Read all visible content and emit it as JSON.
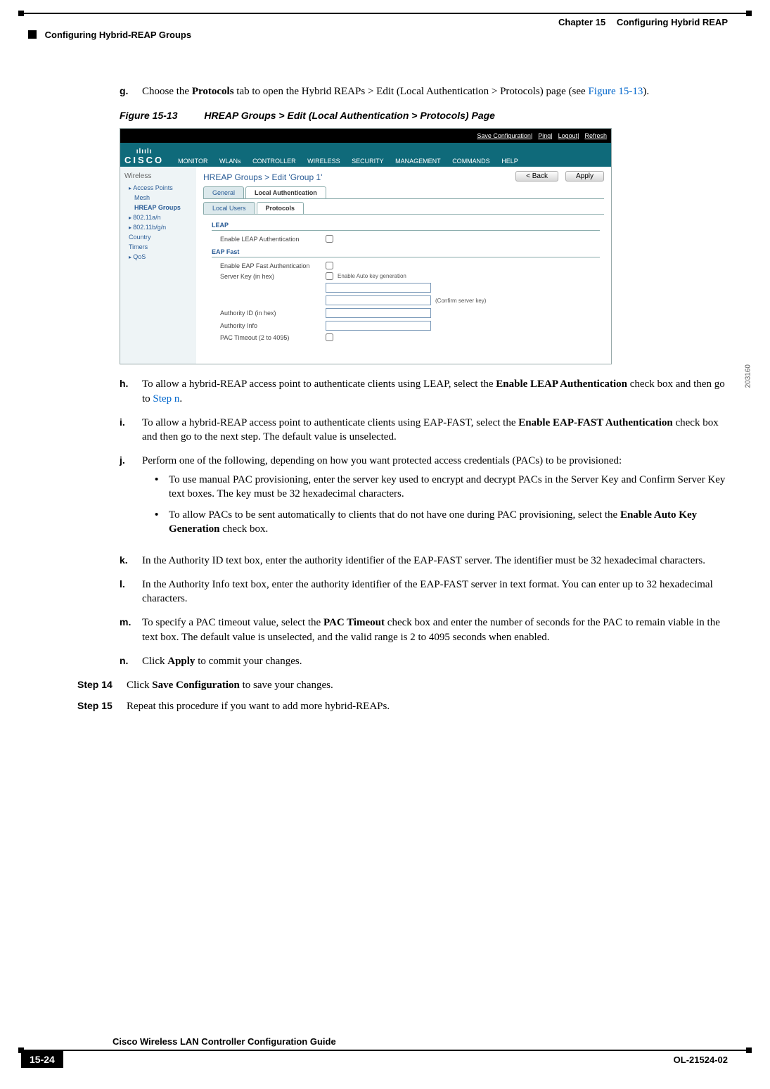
{
  "header": {
    "chapter": "Chapter 15",
    "chapter_title": "Configuring Hybrid REAP",
    "section": "Configuring Hybrid-REAP Groups"
  },
  "footer": {
    "guide_title": "Cisco Wireless LAN Controller Configuration Guide",
    "page_number": "15-24",
    "doc_id": "OL-21524-02"
  },
  "step_g": {
    "marker": "g.",
    "t1": "Choose the ",
    "b1": "Protocols",
    "t2": " tab to open the Hybrid REAPs > Edit (Local Authentication > Protocols) page (see ",
    "link": "Figure 15-13",
    "t3": ")."
  },
  "figure": {
    "label": "Figure 15-13",
    "caption": "HREAP Groups > Edit (Local Authentication > Protocols) Page",
    "image_id": "203160",
    "topbar": {
      "save": "Save Configuration",
      "ping": "Ping",
      "logout": "Logout",
      "refresh": "Refresh"
    },
    "logo_top": "ılıılı",
    "logo": "CISCO",
    "menu": [
      "MONITOR",
      "WLANs",
      "CONTROLLER",
      "WIRELESS",
      "SECURITY",
      "MANAGEMENT",
      "COMMANDS",
      "HELP"
    ],
    "sidebar_title": "Wireless",
    "sidebar": {
      "ap": "Access Points",
      "mesh": "Mesh",
      "hreap": "HREAP Groups",
      "an": "802.11a/n",
      "bgn": "802.11b/g/n",
      "country": "Country",
      "timers": "Timers",
      "qos": "QoS"
    },
    "breadcrumb": "HREAP Groups > Edit   'Group 1'",
    "btn_back": "< Back",
    "btn_apply": "Apply",
    "tab_general": "General",
    "tab_localauth": "Local Authentication",
    "tab_localusers": "Local Users",
    "tab_protocols": "Protocols",
    "sec_leap": "LEAP",
    "lbl_enable_leap": "Enable LEAP Authentication",
    "sec_eapfast": "EAP Fast",
    "lbl_enable_eapfast": "Enable EAP Fast Authentication",
    "lbl_serverkey": "Server Key (in hex)",
    "lbl_autokey": "Enable Auto key generation",
    "lbl_confirm": "(Confirm server key)",
    "lbl_authid": "Authority ID (in hex)",
    "lbl_authinfo": "Authority Info",
    "lbl_pac": "PAC Timeout (2 to 4095)"
  },
  "step_h": {
    "marker": "h.",
    "t1": "To allow a hybrid-REAP access point to authenticate clients using LEAP, select the ",
    "b1": "Enable LEAP Authentication",
    "t2": " check box and then go to ",
    "link": "Step n",
    "t3": "."
  },
  "step_i": {
    "marker": "i.",
    "t1": "To allow a hybrid-REAP access point to authenticate clients using EAP-FAST, select the ",
    "b1": "Enable EAP-FAST Authentication",
    "t2": " check box and then go to the next step. The default value is unselected."
  },
  "step_j": {
    "marker": "j.",
    "t1": "Perform one of the following, depending on how you want protected access credentials (PACs) to be provisioned:",
    "bullet1": "To use manual PAC provisioning, enter the server key used to encrypt and decrypt PACs in the Server Key and Confirm Server Key text boxes. The key must be 32 hexadecimal characters.",
    "bullet2a": "To allow PACs to be sent automatically to clients that do not have one during PAC provisioning, select the ",
    "bullet2b": "Enable Auto Key Generation",
    "bullet2c": " check box."
  },
  "step_k": {
    "marker": "k.",
    "t1": "In the Authority ID text box, enter the authority identifier of the EAP-FAST server. The identifier must be 32 hexadecimal characters."
  },
  "step_l": {
    "marker": "l.",
    "t1": "In the Authority Info text box, enter the authority identifier of the EAP-FAST server in text format. You can enter up to 32 hexadecimal characters."
  },
  "step_m": {
    "marker": "m.",
    "t1": "To specify a PAC timeout value, select the ",
    "b1": "PAC Timeout",
    "t2": " check box and enter the number of seconds for the PAC to remain viable in the text box. The default value is unselected, and the valid range is 2 to 4095 seconds when enabled."
  },
  "step_n": {
    "marker": "n.",
    "t1": "Click ",
    "b1": "Apply",
    "t2": " to commit your changes."
  },
  "step14": {
    "marker": "Step 14",
    "t1": "Click ",
    "b1": "Save Configuration",
    "t2": " to save your changes."
  },
  "step15": {
    "marker": "Step 15",
    "t1": "Repeat this procedure if you want to add more hybrid-REAPs."
  }
}
